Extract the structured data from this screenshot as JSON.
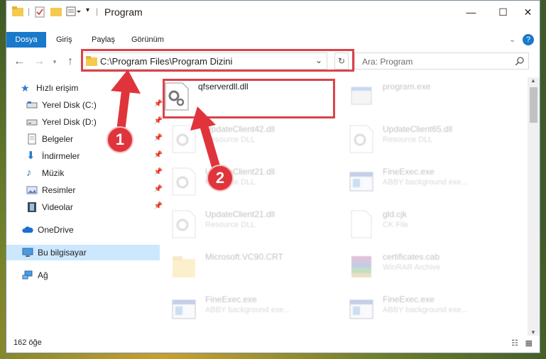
{
  "window": {
    "title": "Program"
  },
  "ribbon": {
    "tabs": [
      "Dosya",
      "Giriş",
      "Paylaş",
      "Görünüm"
    ]
  },
  "address": {
    "path": "C:\\Program Files\\Program Dizini"
  },
  "search": {
    "placeholder": "Ara: Program"
  },
  "sidebar": {
    "quick_access": "Hızlı erişim",
    "items": [
      "Yerel Disk (C:)",
      "Yerel Disk (D:)",
      "Belgeler",
      "İndirmeler",
      "Müzik",
      "Resimler",
      "Videolar"
    ],
    "onedrive": "OneDrive",
    "this_pc": "Bu bilgisayar",
    "network": "Ağ"
  },
  "files": [
    {
      "name": "qfserverdll.dll",
      "sub": ""
    },
    {
      "name": "program.exe",
      "sub": ""
    },
    {
      "name": "UpdateClient42.dll",
      "sub": "Resource DLL"
    },
    {
      "name": "UpdateClient65.dll",
      "sub": "Resource DLL"
    },
    {
      "name": "UpdateClient21.dll",
      "sub": "Resource DLL"
    },
    {
      "name": "FineExec.exe",
      "sub": "ABBY background exe..."
    },
    {
      "name": "UpdateClient21.dll",
      "sub": "Resource DLL"
    },
    {
      "name": "gld.cjk",
      "sub": "CK File"
    },
    {
      "name": "Microsoft.VC90.CRT",
      "sub": ""
    },
    {
      "name": "certificates.cab",
      "sub": "WinRAR Archive"
    },
    {
      "name": "FineExec.exe",
      "sub": "ABBY background exe..."
    },
    {
      "name": "FineExec.exe",
      "sub": "ABBY background exe..."
    }
  ],
  "status": {
    "count": "162 öğe"
  },
  "annotations": {
    "step1": "1",
    "step2": "2"
  },
  "colors": {
    "accent": "#1979ca",
    "highlight": "#d9434b"
  }
}
